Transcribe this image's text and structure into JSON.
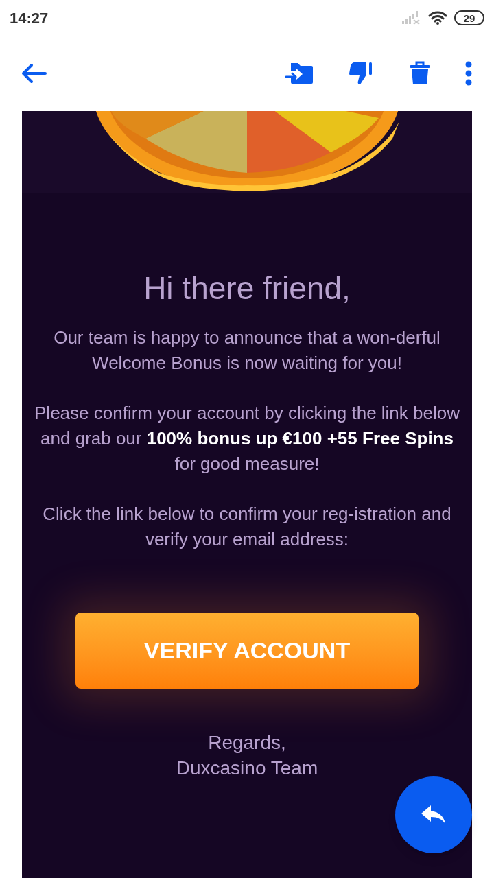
{
  "status_bar": {
    "time": "14:27",
    "battery": "29"
  },
  "toolbar": {
    "actions": [
      {
        "kind": "move"
      },
      {
        "kind": "spam"
      },
      {
        "kind": "delete"
      },
      {
        "kind": "more"
      }
    ]
  },
  "email": {
    "greeting": "Hi there friend,",
    "paragraphs": [
      "Our team is happy to announce that a won-derful Welcome Bonus is now waiting for you!",
      "Please confirm your account by clicking the link below and grab our **100% bonus up €100 +55 Free Spins** for good measure!",
      "Click the link below to confirm your reg-istration and verify your email address:"
    ],
    "button": "VERIFY ACCOUNT",
    "signature": [
      "Regards,",
      "Duxcasino Team"
    ]
  }
}
